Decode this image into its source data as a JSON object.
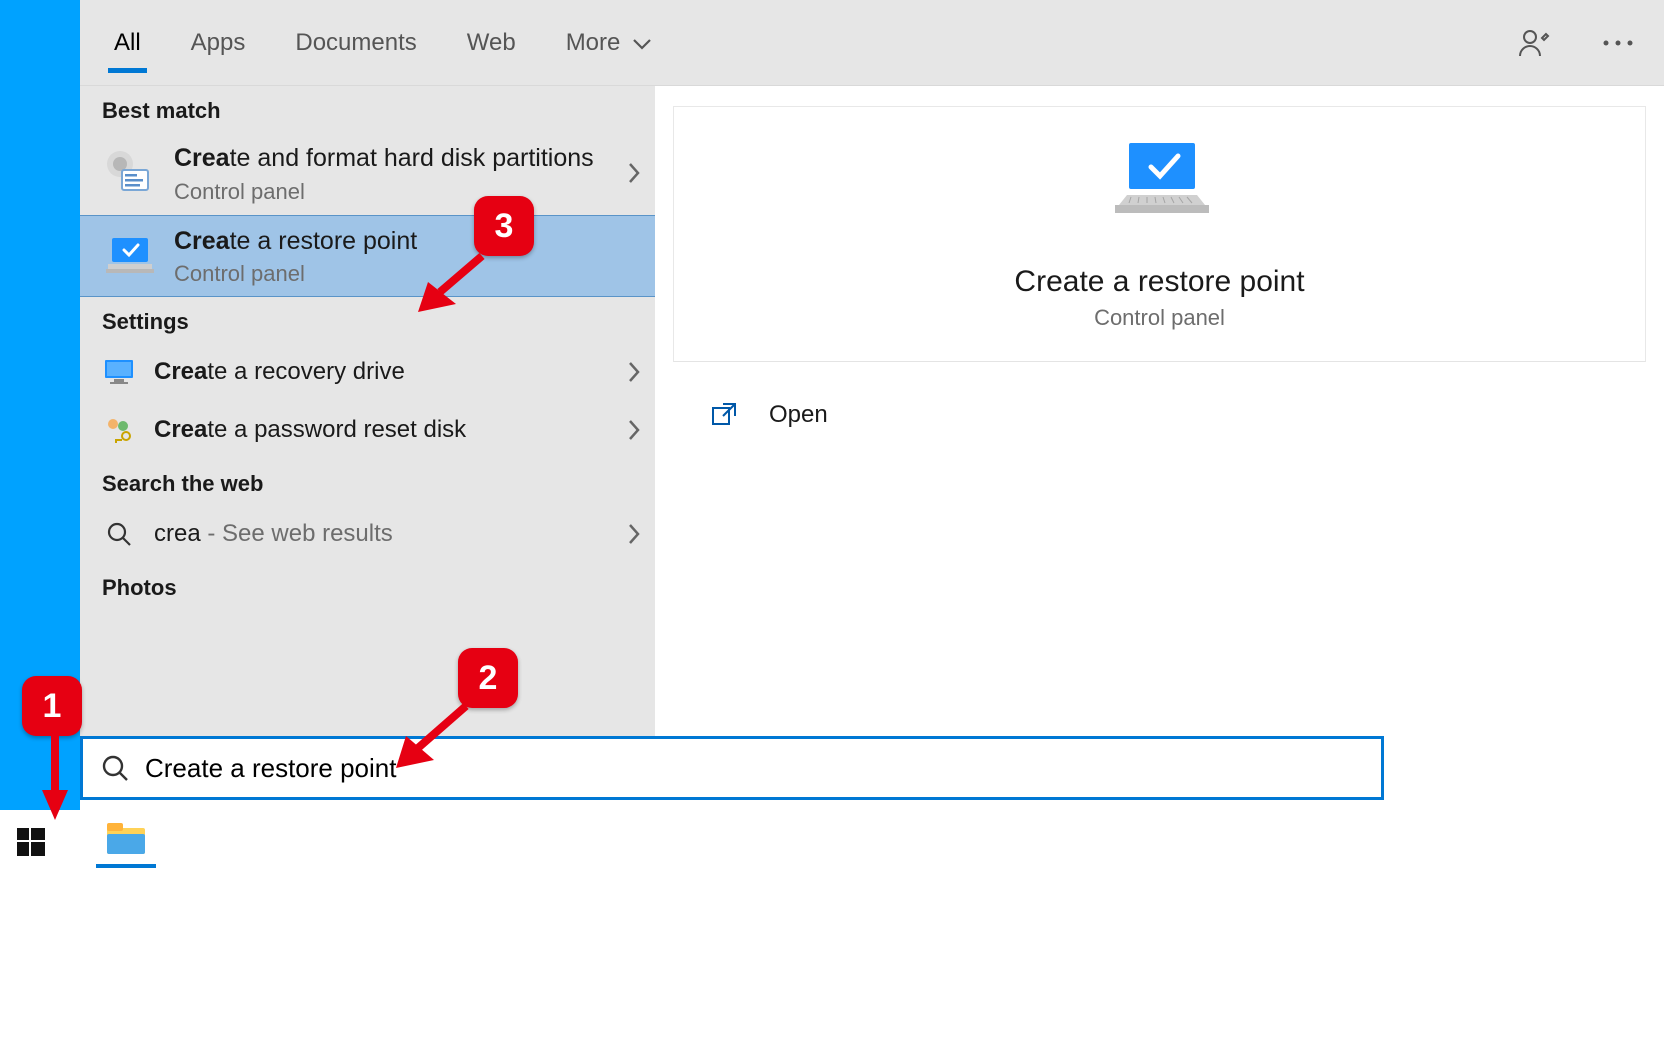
{
  "tabs": {
    "all": "All",
    "apps": "Apps",
    "documents": "Documents",
    "web": "Web",
    "more": "More"
  },
  "sections": {
    "best_match": "Best match",
    "settings": "Settings",
    "search_web": "Search the web",
    "photos": "Photos"
  },
  "results": {
    "best1": {
      "bold": "Crea",
      "rest": "te and format hard disk partitions",
      "sub": "Control panel"
    },
    "best2": {
      "bold": "Crea",
      "rest": "te a restore point",
      "sub": "Control panel"
    },
    "set1": {
      "bold": "Crea",
      "rest": "te a recovery drive"
    },
    "set2": {
      "bold": "Crea",
      "rest": "te a password reset disk"
    },
    "web1": {
      "query": "crea",
      "rest": " - See web results"
    }
  },
  "detail": {
    "title": "Create a restore point",
    "sub": "Control panel",
    "open": "Open"
  },
  "search": {
    "value": "Create a restore point"
  },
  "annotations": {
    "b1": "1",
    "b2": "2",
    "b3": "3"
  }
}
